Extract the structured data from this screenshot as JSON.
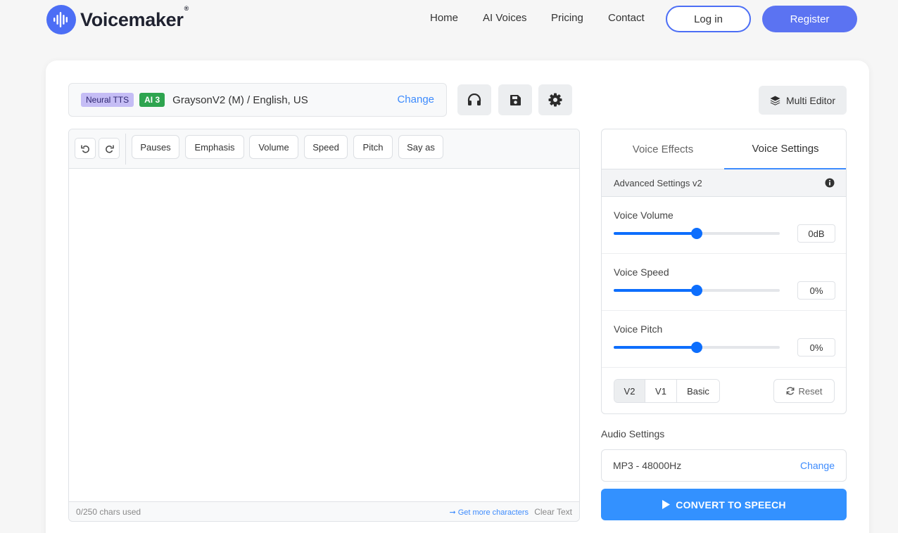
{
  "nav": {
    "logo_text": "Voicemaker",
    "logo_reg": "®",
    "links": [
      "Home",
      "AI Voices",
      "Pricing",
      "Contact"
    ],
    "login_label": "Log in",
    "register_label": "Register"
  },
  "voice": {
    "badge_engine": "Neural TTS",
    "badge_tier": "AI 3",
    "name": "GraysonV2 (M) / English, US",
    "change_label": "Change"
  },
  "toolbar_icons": [
    "headphones-icon",
    "save-icon",
    "settings-icon"
  ],
  "multi_editor_label": "Multi Editor",
  "editor": {
    "buttons": [
      "Pauses",
      "Emphasis",
      "Volume",
      "Speed",
      "Pitch",
      "Say as"
    ],
    "text": "",
    "chars_used": "0/250 chars used",
    "get_more": "Get more characters",
    "clear_text": "Clear Text"
  },
  "panel": {
    "tabs": [
      "Voice Effects",
      "Voice Settings"
    ],
    "active_tab": "Voice Settings",
    "advanced_label": "Advanced Settings v2",
    "settings": [
      {
        "label": "Voice Volume",
        "value": "0dB",
        "level": 0.5
      },
      {
        "label": "Voice Speed",
        "value": "0%",
        "level": 0.5
      },
      {
        "label": "Voice Pitch",
        "value": "0%",
        "level": 0.5
      }
    ],
    "versions": [
      "V2",
      "V1",
      "Basic"
    ],
    "active_version": "V2",
    "reset_label": "Reset"
  },
  "audio": {
    "title": "Audio Settings",
    "format": "MP3 - 48000Hz",
    "change_label": "Change"
  },
  "convert_label": "CONVERT TO SPEECH",
  "colors": {
    "brand": "#4c6ef5",
    "accent": "#3391ff",
    "slider": "#0d6efd",
    "badge_ai": "#2ea44f",
    "badge_neural": "#c5bdf5"
  }
}
